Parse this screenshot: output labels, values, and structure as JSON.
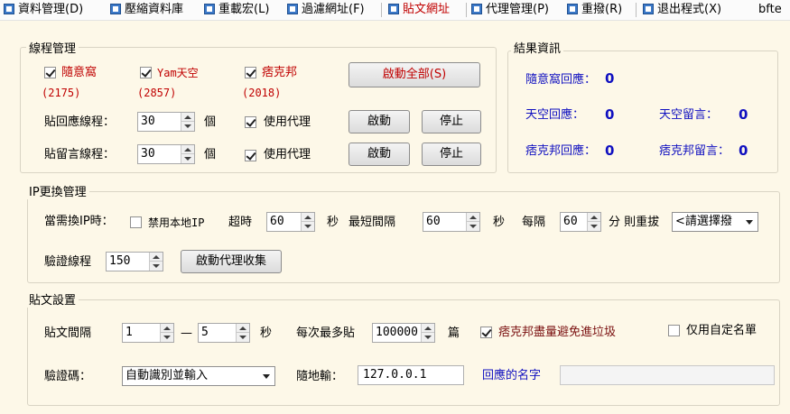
{
  "menu": {
    "items": [
      {
        "label": "資料管理(D)"
      },
      {
        "label": "壓縮資料庫"
      },
      {
        "label": "重載宏(L)"
      },
      {
        "label": "過濾網址(F)"
      },
      {
        "label": "貼文網址"
      },
      {
        "label": "代理管理(P)"
      },
      {
        "label": "重撥(R)"
      },
      {
        "label": "退出程式(X)"
      }
    ],
    "trailing": "bfte"
  },
  "thread_mgmt": {
    "title": "線程管理",
    "sites": [
      {
        "name": "隨意窩",
        "count": "(2175)",
        "checked": true
      },
      {
        "name": "Yam天空",
        "count": "(2857)",
        "checked": true
      },
      {
        "name": "痞克邦",
        "count": "(2018)",
        "checked": true
      }
    ],
    "start_all_label": "啟動全部(S)",
    "reply_row": {
      "label": "貼回應線程：",
      "value": "30",
      "unit": "個",
      "proxy_label": "使用代理",
      "start": "啟動",
      "stop": "停止"
    },
    "msg_row": {
      "label": "貼留言線程：",
      "value": "30",
      "unit": "個",
      "proxy_label": "使用代理",
      "start": "啟動",
      "stop": "停止"
    }
  },
  "results": {
    "title": "結果資訊",
    "xuite_reply_label": "隨意窩回應：",
    "xuite_reply_value": "0",
    "yam_reply_label": "天空回應：",
    "yam_reply_value": "0",
    "yam_msg_label": "天空留言：",
    "yam_msg_value": "0",
    "pix_reply_label": "痞克邦回應：",
    "pix_reply_value": "0",
    "pix_msg_label": "痞克邦留言：",
    "pix_msg_value": "0"
  },
  "ip_mgmt": {
    "title": "IP更換管理",
    "need_change_label": "當需換IP時：",
    "disable_local_label": "禁用本地IP",
    "timeout_label": "超時",
    "timeout_value": "60",
    "sec1": "秒",
    "min_interval_label": "最短間隔",
    "min_interval_value": "60",
    "sec2": "秒",
    "every_label": "每隔",
    "every_value": "60",
    "redial_label": "分 則重拔",
    "dial_select": "<請選擇撥",
    "verify_threads_label": "驗證線程",
    "verify_threads_value": "150",
    "proxy_collect_label": "啟動代理收集"
  },
  "post_settings": {
    "title": "貼文設置",
    "interval_label": "貼文間隔",
    "interval_from": "1",
    "dash": "—",
    "interval_to": "5",
    "sec": "秒",
    "max_label": "每次最多貼",
    "max_value": "100000",
    "unit": "篇",
    "pix_avoid_label": "痞克邦盡量避免進垃圾",
    "custom_list_label": "仅用自定名單",
    "captcha_label": "驗證碼：",
    "captcha_select": "自動識別並輸入",
    "ip_label": "隨地輸：",
    "ip_value": "127.0.0.1",
    "reply_name_label": "回應的名字",
    "reply_name_value": ""
  }
}
